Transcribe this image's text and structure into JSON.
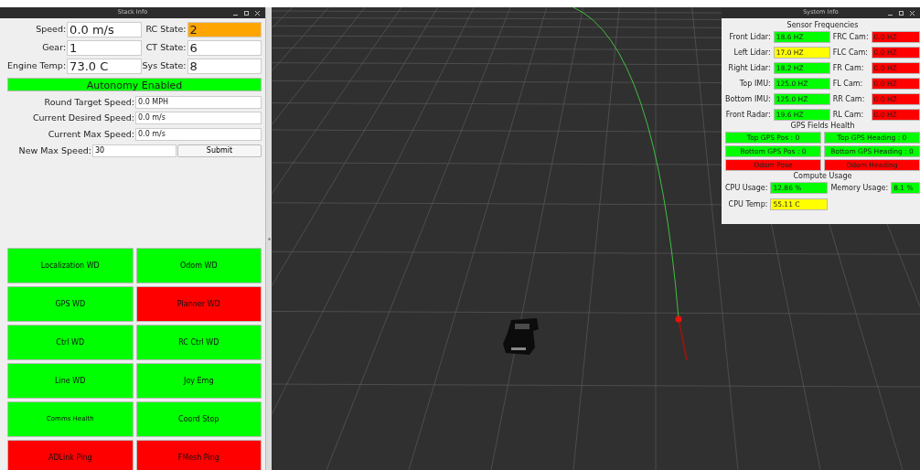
{
  "stack_info": {
    "title": "Stack Info",
    "readouts": [
      {
        "label": "Speed:",
        "value": "0.0 m/s",
        "color": "#ffffff"
      },
      {
        "label": "RC State:",
        "value": "2",
        "color": "#ffa500"
      },
      {
        "label": "Gear:",
        "value": "1",
        "color": "#ffffff"
      },
      {
        "label": "CT State:",
        "value": "6",
        "color": "#ffffff"
      },
      {
        "label": "Engine Temp:",
        "value": "73.0 C",
        "color": "#ffffff"
      },
      {
        "label": "Sys State:",
        "value": "8",
        "color": "#ffffff"
      }
    ],
    "autonomy_banner": {
      "text": "Autonomy Enabled",
      "color": "#00ff00"
    },
    "speed_fields": [
      {
        "label": "Round Target Speed:",
        "value": "0.0 MPH"
      },
      {
        "label": "Current Desired Speed:",
        "value": "0.0 m/s"
      },
      {
        "label": "Current Max Speed:",
        "value": "0.0 m/s"
      }
    ],
    "new_max_speed": {
      "label": "New Max Speed:",
      "value": "30",
      "button": "Submit"
    },
    "watchdogs": [
      {
        "label": "Localization WD",
        "color": "#00ff00",
        "small_text": false
      },
      {
        "label": "Odom WD",
        "color": "#00ff00",
        "small_text": false
      },
      {
        "label": "GPS WD",
        "color": "#00ff00",
        "small_text": false
      },
      {
        "label": "Planner WD",
        "color": "#ff0000",
        "small_text": false
      },
      {
        "label": "Ctrl WD",
        "color": "#00ff00",
        "small_text": false
      },
      {
        "label": "RC Ctrl WD",
        "color": "#00ff00",
        "small_text": false
      },
      {
        "label": "Line WD",
        "color": "#00ff00",
        "small_text": false
      },
      {
        "label": "Joy Emg",
        "color": "#00ff00",
        "small_text": false
      },
      {
        "label": "Comms Health",
        "color": "#00ff00",
        "small_text": true
      },
      {
        "label": "Coord Stop",
        "color": "#00ff00",
        "small_text": false
      },
      {
        "label": "ADLink Ping",
        "color": "#ff0000",
        "small_text": false
      },
      {
        "label": "FMesh Ping",
        "color": "#ff0000",
        "small_text": false
      }
    ]
  },
  "system_info": {
    "title": "System Info",
    "sensor_title": "Sensor Frequencies",
    "sensors": [
      {
        "label": "Front Lidar:",
        "value": "18.6 HZ",
        "color": "#00ff00"
      },
      {
        "label": "FRC Cam:",
        "value": "0.0 HZ",
        "color": "#ff0000"
      },
      {
        "label": "Left Lidar:",
        "value": "17.0 HZ",
        "color": "#ffff00"
      },
      {
        "label": "FLC Cam:",
        "value": "0.0 HZ",
        "color": "#ff0000"
      },
      {
        "label": "Right Lidar:",
        "value": "18.2 HZ",
        "color": "#00ff00"
      },
      {
        "label": "FR Cam:",
        "value": "0.0 HZ",
        "color": "#ff0000"
      },
      {
        "label": "Top IMU:",
        "value": "125.0 HZ",
        "color": "#00ff00"
      },
      {
        "label": "FL Cam:",
        "value": "0.0 HZ",
        "color": "#ff0000"
      },
      {
        "label": "Bottom IMU:",
        "value": "125.0 HZ",
        "color": "#00ff00"
      },
      {
        "label": "RR Cam:",
        "value": "0.0 HZ",
        "color": "#ff0000"
      },
      {
        "label": "Front Radar:",
        "value": "19.6 HZ",
        "color": "#00ff00"
      },
      {
        "label": "RL Cam:",
        "value": "0.0 HZ",
        "color": "#ff0000"
      }
    ],
    "gps_title": "GPS Fields Health",
    "gps": [
      {
        "label": "Top GPS Pos : 0",
        "color": "#00ff00"
      },
      {
        "label": "Top GPS Heading : 0",
        "color": "#00ff00"
      },
      {
        "label": "Bottom GPS Pos : 0",
        "color": "#00ff00"
      },
      {
        "label": "Bottom GPS Heading : 0",
        "color": "#00ff00"
      },
      {
        "label": "Odom Pose",
        "color": "#ff0000"
      },
      {
        "label": "Odom Heading",
        "color": "#ff0000"
      }
    ],
    "compute_title": "Compute Usage",
    "compute": [
      {
        "label": "CPU Usage:",
        "value": "12.86 %",
        "color": "#00ff00"
      },
      {
        "label": "Memory Usage:",
        "value": "8.1 %",
        "color": "#00ff00"
      },
      {
        "label": "CPU Temp:",
        "value": "55.11 C",
        "color": "#ffff00"
      }
    ]
  }
}
